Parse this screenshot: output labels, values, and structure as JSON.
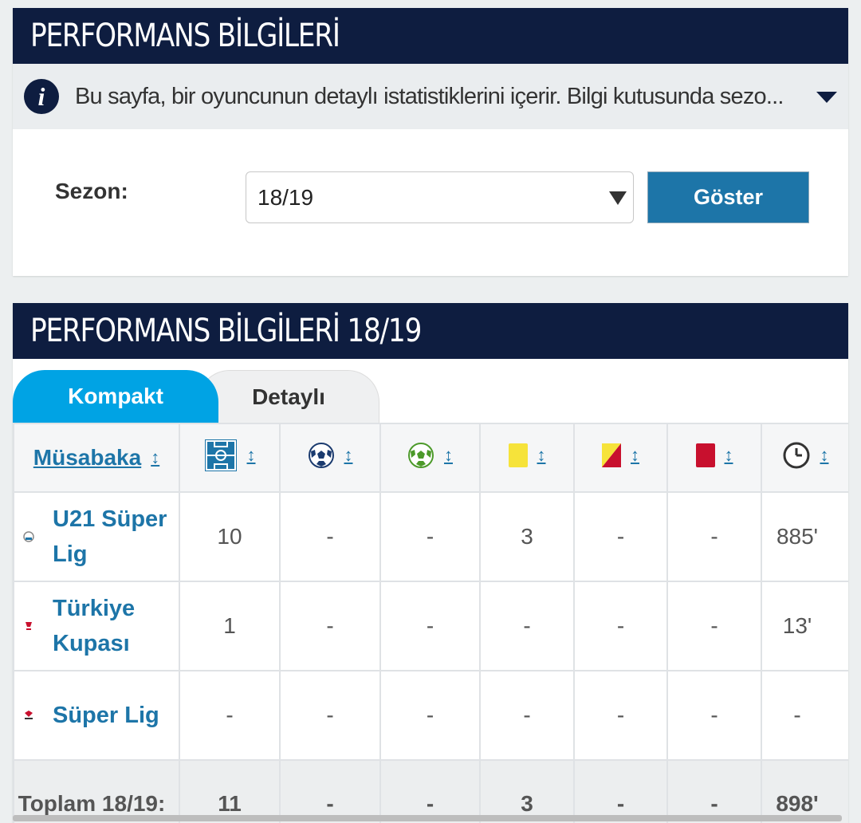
{
  "season_box": {
    "title": "PERFORMANS BİLGİLERİ",
    "info_text": "Bu sayfa, bir oyuncunun detaylı istatistiklerini içerir. Bilgi kutusunda sezo...",
    "season_label": "Sezon:",
    "season_selected": "18/19",
    "show_button": "Göster"
  },
  "perf_box": {
    "title": "PERFORMANS BİLGİLERİ 18/19",
    "tabs": [
      {
        "label": "Kompakt",
        "active": true
      },
      {
        "label": "Detaylı",
        "active": false
      }
    ],
    "columns": [
      {
        "label": "Müsabaka",
        "icon": "competition"
      },
      {
        "label": "",
        "icon": "pitch-icon"
      },
      {
        "label": "",
        "icon": "goal-ball-icon"
      },
      {
        "label": "",
        "icon": "assist-ball-icon"
      },
      {
        "label": "",
        "icon": "yellow-card-icon"
      },
      {
        "label": "",
        "icon": "yellow-red-card-icon"
      },
      {
        "label": "",
        "icon": "red-card-icon"
      },
      {
        "label": "",
        "icon": "clock-icon"
      }
    ],
    "sort_glyph": "↕",
    "rows": [
      {
        "competition": "U21 Süper Lig",
        "apps": "10",
        "goals": "-",
        "assists": "-",
        "yellow": "3",
        "yellow_red": "-",
        "red": "-",
        "minutes": "885'"
      },
      {
        "competition": "Türkiye Kupası",
        "apps": "1",
        "goals": "-",
        "assists": "-",
        "yellow": "-",
        "yellow_red": "-",
        "red": "-",
        "minutes": "13'"
      },
      {
        "competition": "Süper Lig",
        "apps": "-",
        "goals": "-",
        "assists": "-",
        "yellow": "-",
        "yellow_red": "-",
        "red": "-",
        "minutes": "-"
      }
    ],
    "total": {
      "label": "Toplam 18/19:",
      "apps": "11",
      "goals": "-",
      "assists": "-",
      "yellow": "3",
      "yellow_red": "-",
      "red": "-",
      "minutes": "898'"
    }
  },
  "colors": {
    "header_navy": "#0e1d40",
    "link_blue": "#1d75a8",
    "tab_active": "#00a3e4",
    "yellow_card": "#f6e33a",
    "red_card": "#c8102e"
  }
}
